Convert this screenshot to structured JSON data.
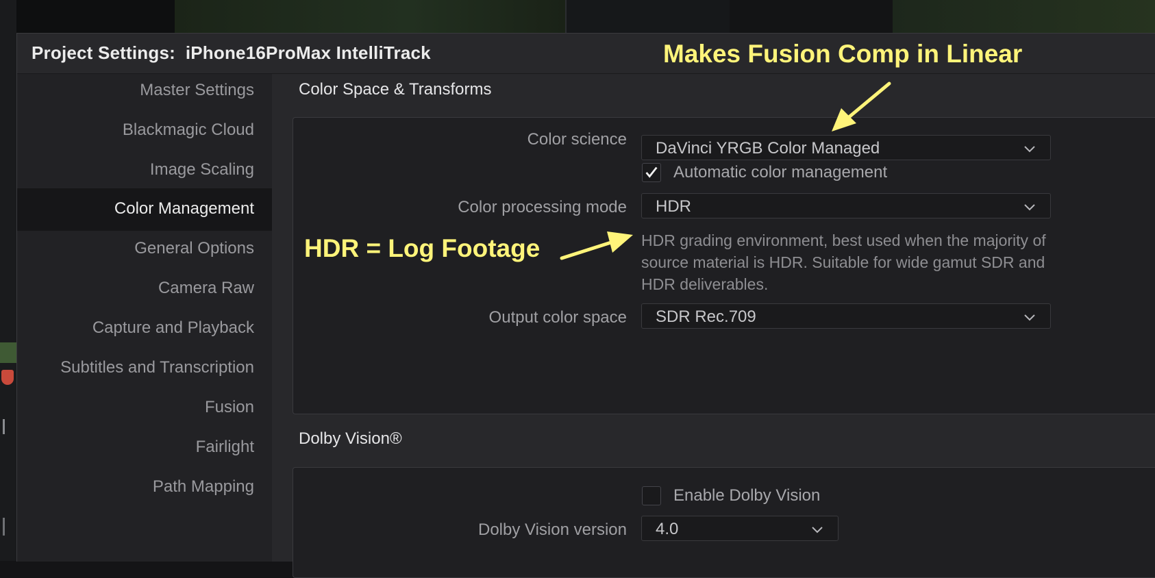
{
  "window": {
    "title": "Project Settings:  iPhone16ProMax IntelliTrack"
  },
  "sidebar": {
    "items": [
      {
        "label": "Master Settings"
      },
      {
        "label": "Blackmagic Cloud"
      },
      {
        "label": "Image Scaling"
      },
      {
        "label": "Color Management"
      },
      {
        "label": "General Options"
      },
      {
        "label": "Camera Raw"
      },
      {
        "label": "Capture and Playback"
      },
      {
        "label": "Subtitles and Transcription"
      },
      {
        "label": "Fusion"
      },
      {
        "label": "Fairlight"
      },
      {
        "label": "Path Mapping"
      }
    ],
    "active_index": 3
  },
  "color_space": {
    "section_title": "Color Space & Transforms",
    "color_science": {
      "label": "Color science",
      "value": "DaVinci YRGB Color Managed"
    },
    "auto_cm": {
      "label": "Automatic color management",
      "checked": true
    },
    "processing_mode": {
      "label": "Color processing mode",
      "value": "HDR"
    },
    "description": "HDR grading environment, best used when the majority of source material is HDR. Suitable for wide gamut SDR and HDR deliverables.",
    "output_color_space": {
      "label": "Output color space",
      "value": "SDR Rec.709"
    }
  },
  "dolby": {
    "section_title": "Dolby Vision®",
    "enable": {
      "label": "Enable Dolby Vision",
      "checked": false
    },
    "version": {
      "label": "Dolby Vision version",
      "value": "4.0"
    }
  },
  "annotations": {
    "fusion_note": "Makes Fusion Comp in Linear",
    "hdr_note": "HDR = Log Footage",
    "color": "#fff47a"
  },
  "icons": {
    "dropdown": "chevron-down-icon",
    "check": "checkmark-icon",
    "arrow": "arrow-icon"
  }
}
